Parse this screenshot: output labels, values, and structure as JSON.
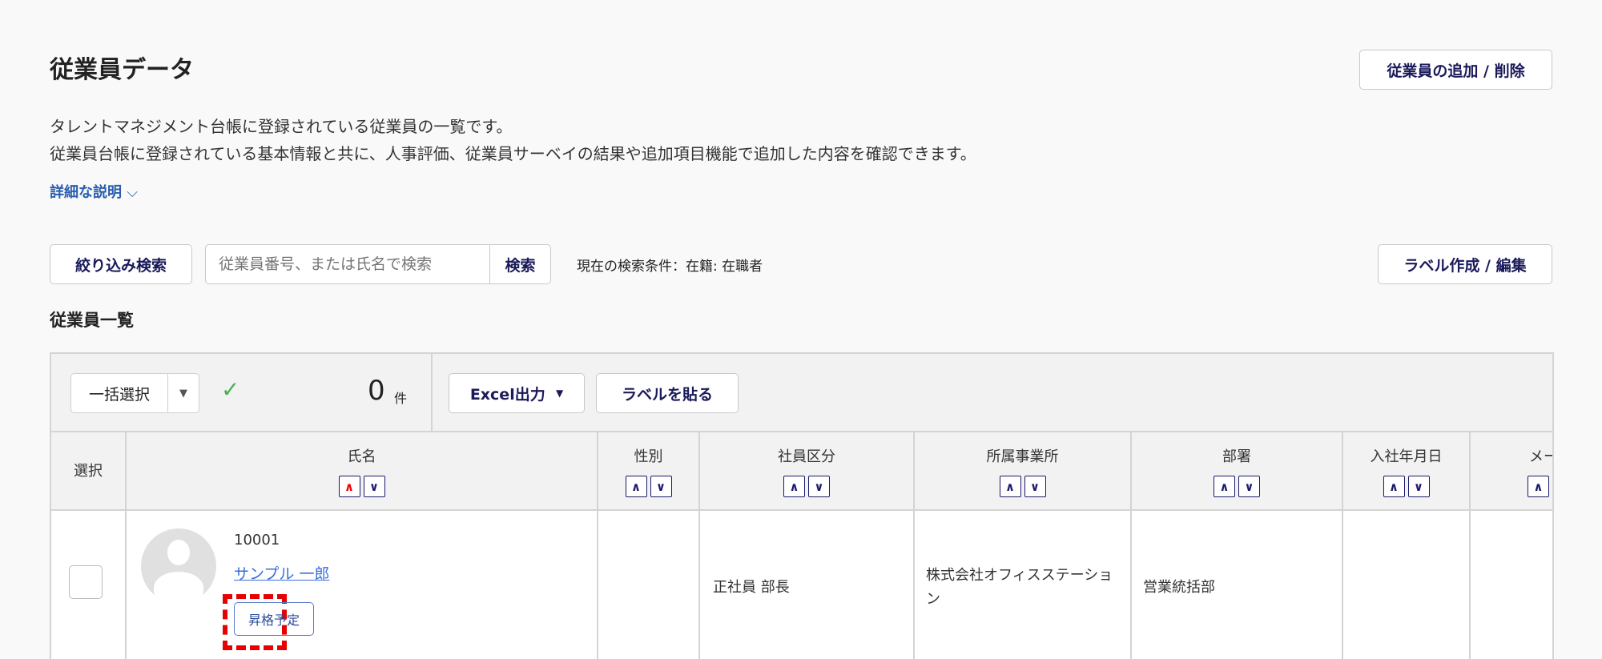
{
  "page": {
    "title": "従業員データ",
    "add_remove_button": "従業員の追加 / 削除",
    "desc_line1": "タレントマネジメント台帳に登録されている従業員の一覧です。",
    "desc_line2": "従業員台帳に登録されている基本情報と共に、人事評価、従業員サーベイの結果や追加項目機能で追加した内容を確認できます。",
    "details_link": "詳細な説明"
  },
  "search": {
    "filter_button": "絞り込み検索",
    "placeholder": "従業員番号、または氏名で検索",
    "search_button": "検索",
    "condition": "現在の検索条件：在籍: 在職者",
    "label_edit_button": "ラベル作成 / 編集"
  },
  "list": {
    "title": "従業員一覧",
    "bulk_select": "一括選択",
    "count": "0",
    "count_unit": "件",
    "excel_button": "Excel出力",
    "paste_label_button": "ラベルを貼る"
  },
  "columns": [
    "選択",
    "氏名",
    "性別",
    "社員区分",
    "所属事業所",
    "部署",
    "入社年月日",
    "メール"
  ],
  "rows": [
    {
      "id": "10001",
      "name": "サンプル 一郎",
      "tag": "昇格予定",
      "gender": "",
      "type": "正社員 部長",
      "office": "株式会社オフィスステーション",
      "dept": "営業統括部",
      "hire_date": ""
    }
  ],
  "colors": {
    "accent": "#1a1a5a",
    "link": "#2a5db0",
    "highlight": "#e60000"
  }
}
